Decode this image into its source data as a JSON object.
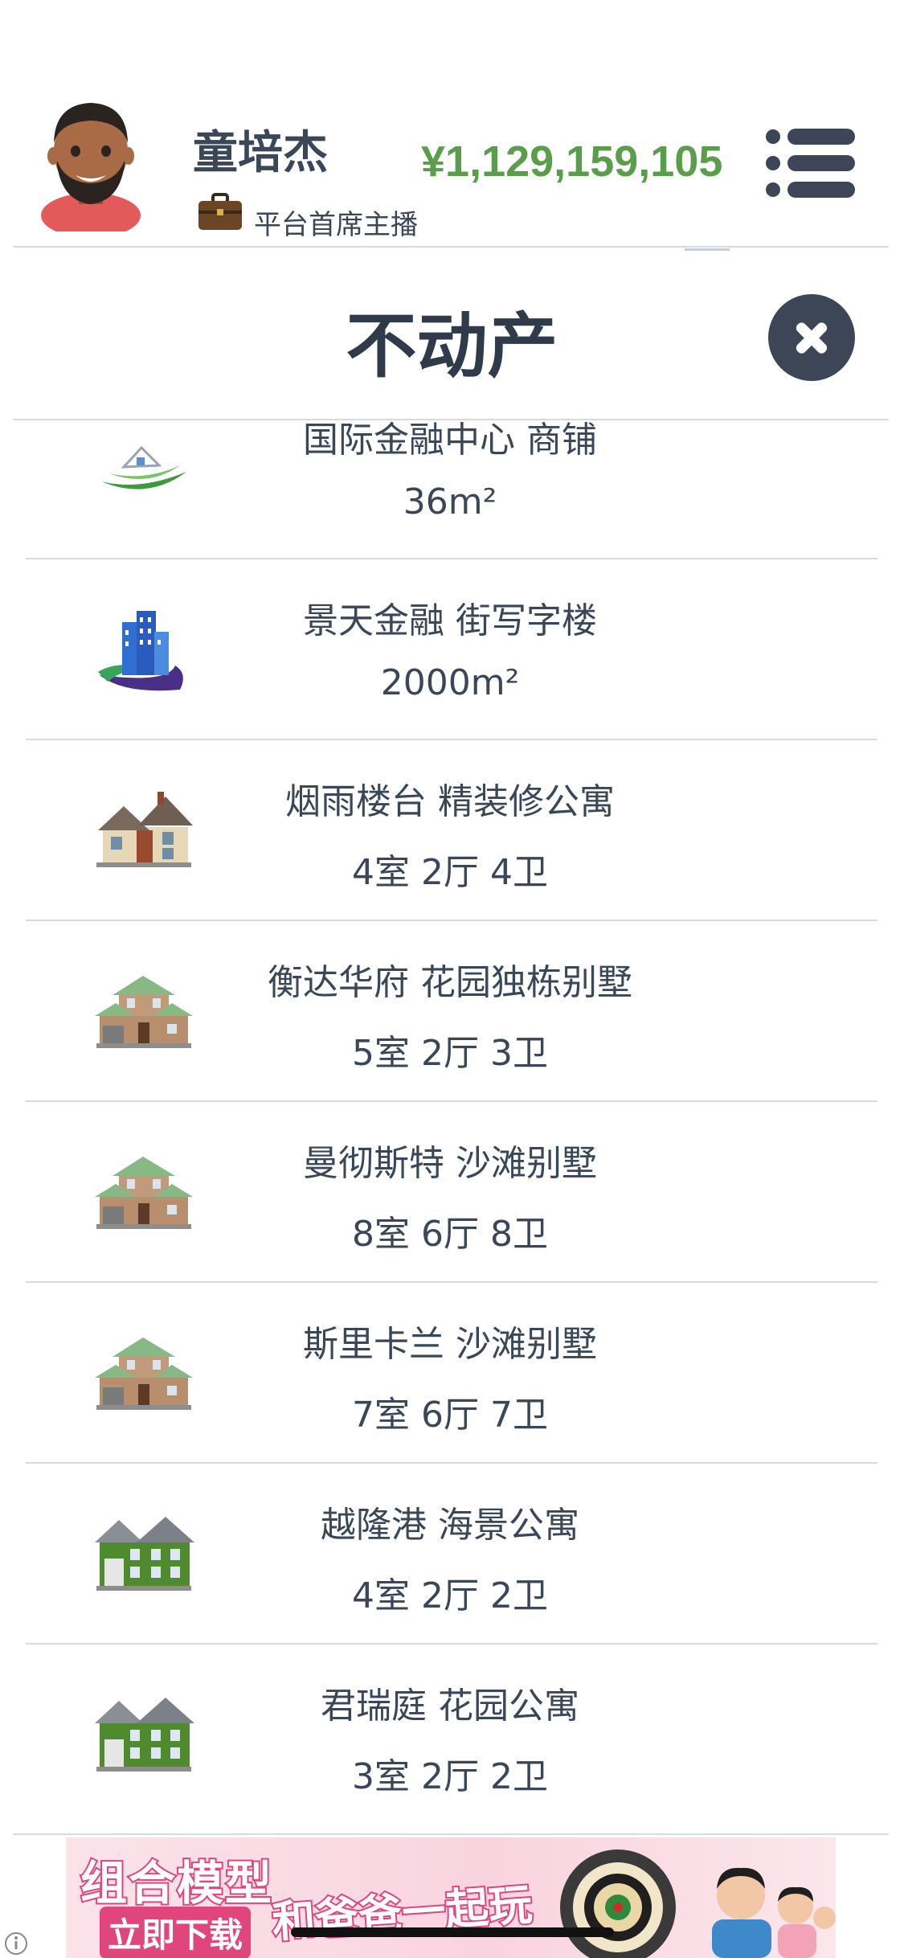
{
  "header": {
    "player_name": "童培杰",
    "player_title": "平台首席主播",
    "money": "¥1,129,159,105"
  },
  "section": {
    "title": "不动产"
  },
  "properties": [
    {
      "name": "国际金融中心 商铺",
      "detail": "36m²",
      "icon": "shop-house-icon"
    },
    {
      "name": "景天金融 街写字楼",
      "detail": "2000m²",
      "icon": "office-building-icon"
    },
    {
      "name": "烟雨楼台 精装修公寓",
      "detail": "4室 2厅 4卫",
      "icon": "brick-house-icon"
    },
    {
      "name": "衡达华府 花园独栋别墅",
      "detail": "5室 2厅 3卫",
      "icon": "villa-icon"
    },
    {
      "name": "曼彻斯特 沙滩别墅",
      "detail": "8室 6厅 8卫",
      "icon": "villa-icon"
    },
    {
      "name": "斯里卡兰 沙滩别墅",
      "detail": "7室 6厅 7卫",
      "icon": "villa-icon"
    },
    {
      "name": "越隆港 海景公寓",
      "detail": "4室 2厅 2卫",
      "icon": "green-house-icon"
    },
    {
      "name": "君瑞庭 花园公寓",
      "detail": "3室 2厅 2卫",
      "icon": "green-house-icon"
    }
  ],
  "ad": {
    "line1": "组合模型",
    "line2": "立即下载",
    "line3": "和爸爸一起玩"
  },
  "colors": {
    "money": "#5a9e4b",
    "close_button": "#3c4657",
    "ad_accent": "#e0457b"
  }
}
